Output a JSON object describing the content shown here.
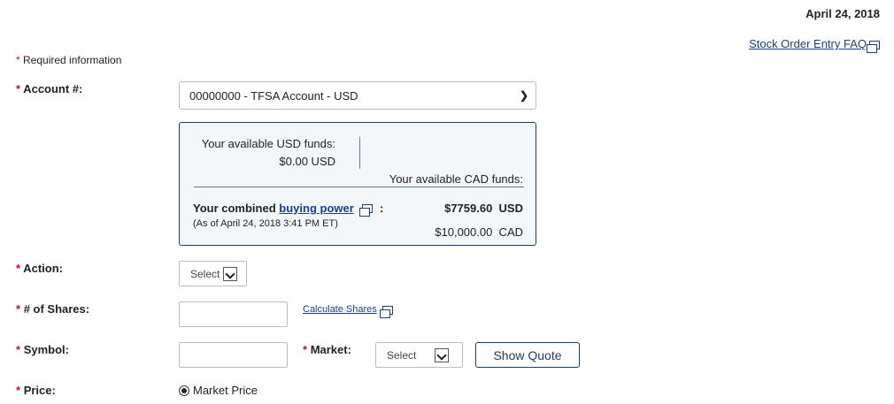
{
  "header": {
    "date": "April 24, 2018",
    "faq_link": "Stock Order Entry FAQ"
  },
  "required_info": {
    "marker": "*",
    "text": "Required information"
  },
  "account": {
    "label": "Account #:",
    "selected": "00000000 - TFSA Account - USD",
    "chevron_icon": "chevron-down-icon"
  },
  "funds": {
    "usd_label": "Your available USD funds:",
    "usd_value": "$0.00 USD",
    "cad_label": "Your available CAD funds:",
    "cad_value": "$10,000.00  CAD",
    "combined_prefix": "Your combined",
    "buying_power_link": "buying power",
    "combined_suffix": ":",
    "combined_value": "$7759.60  USD",
    "as_of": "(As of April 24, 2018 3:41 PM ET)"
  },
  "action": {
    "label": "Action:",
    "select_value": "Select"
  },
  "shares": {
    "label": "# of Shares:",
    "value": "",
    "calculate_link": "Calculate Shares"
  },
  "symbol": {
    "label": "Symbol:",
    "value": ""
  },
  "market": {
    "label": "Market:",
    "select_value": "Select",
    "show_quote_label": "Show Quote"
  },
  "price": {
    "label": "Price:",
    "option_market": "Market Price",
    "market_selected": true
  },
  "colors": {
    "required": "#c8102e",
    "link": "#1a3e8c",
    "box_border": "#1a3e6c",
    "box_bg": "#f4f7fa"
  }
}
